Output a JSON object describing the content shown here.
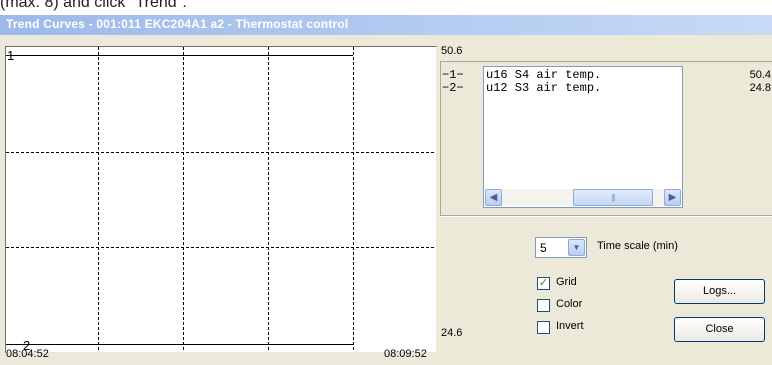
{
  "caption": {
    "text": "(max. 8) and click \"Trend\"."
  },
  "window": {
    "title": "Trend Curves - 001:011  EKC204A1 a2 - Thermostat control"
  },
  "plot": {
    "y_max": "50.6",
    "y_min": "24.6",
    "time_start": "08:04:52",
    "time_end": "08:09:52",
    "series_markers": [
      "1",
      "2"
    ]
  },
  "legend": {
    "items": [
      {
        "key": "−1−",
        "name": "u16 S4 air temp.",
        "value": "50.4"
      },
      {
        "key": "−2−",
        "name": "u12 S3 air temp.",
        "value": "24.8"
      }
    ]
  },
  "controls": {
    "time_scale_value": "5",
    "time_scale_label": "Time scale (min)",
    "grid_label": "Grid",
    "grid_checked": true,
    "color_label": "Color",
    "color_checked": false,
    "invert_label": "Invert",
    "invert_checked": false,
    "logs_label": "Logs...",
    "close_label": "Close"
  },
  "icons": {
    "scroll_left": "scroll-left-icon",
    "scroll_right": "scroll-right-icon",
    "dropdown": "chevron-down-icon",
    "checkmark": "checkmark-icon"
  }
}
